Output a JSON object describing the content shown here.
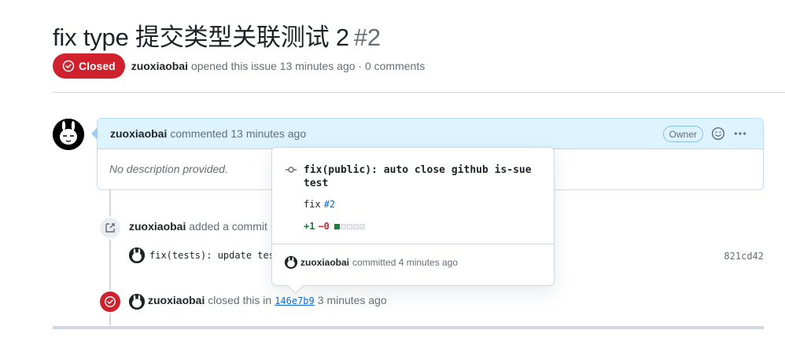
{
  "issue": {
    "title": "fix type 提交类型关联测试 2",
    "number": "#2",
    "state_label": "Closed",
    "author": "zuoxiaobai",
    "meta_text": "opened this issue 13 minutes ago · 0 comments"
  },
  "comment": {
    "author": "zuoxiaobai",
    "time_text": "commented 13 minutes ago",
    "owner_label": "Owner",
    "body": "No description provided."
  },
  "timeline": {
    "commit_event": {
      "author": "zuoxiaobai",
      "text": "added a commit"
    },
    "commit": {
      "message": "fix(tests): update tes",
      "sha": "821cd42"
    },
    "closed_event": {
      "author": "zuoxiaobai",
      "text_before": "closed this in",
      "sha": "146e7b9",
      "text_after": "3 minutes ago"
    }
  },
  "popover": {
    "title": "fix(public): auto close github is-sue test",
    "desc": "fix",
    "ref": "#2",
    "additions": "+1",
    "deletions": "−0",
    "author": "zuoxiaobai",
    "footer_text": "committed 4 minutes ago"
  },
  "colors": {
    "closed": "#cf222e",
    "link": "#0969da",
    "comment_header_bg": "#ddf4ff"
  }
}
